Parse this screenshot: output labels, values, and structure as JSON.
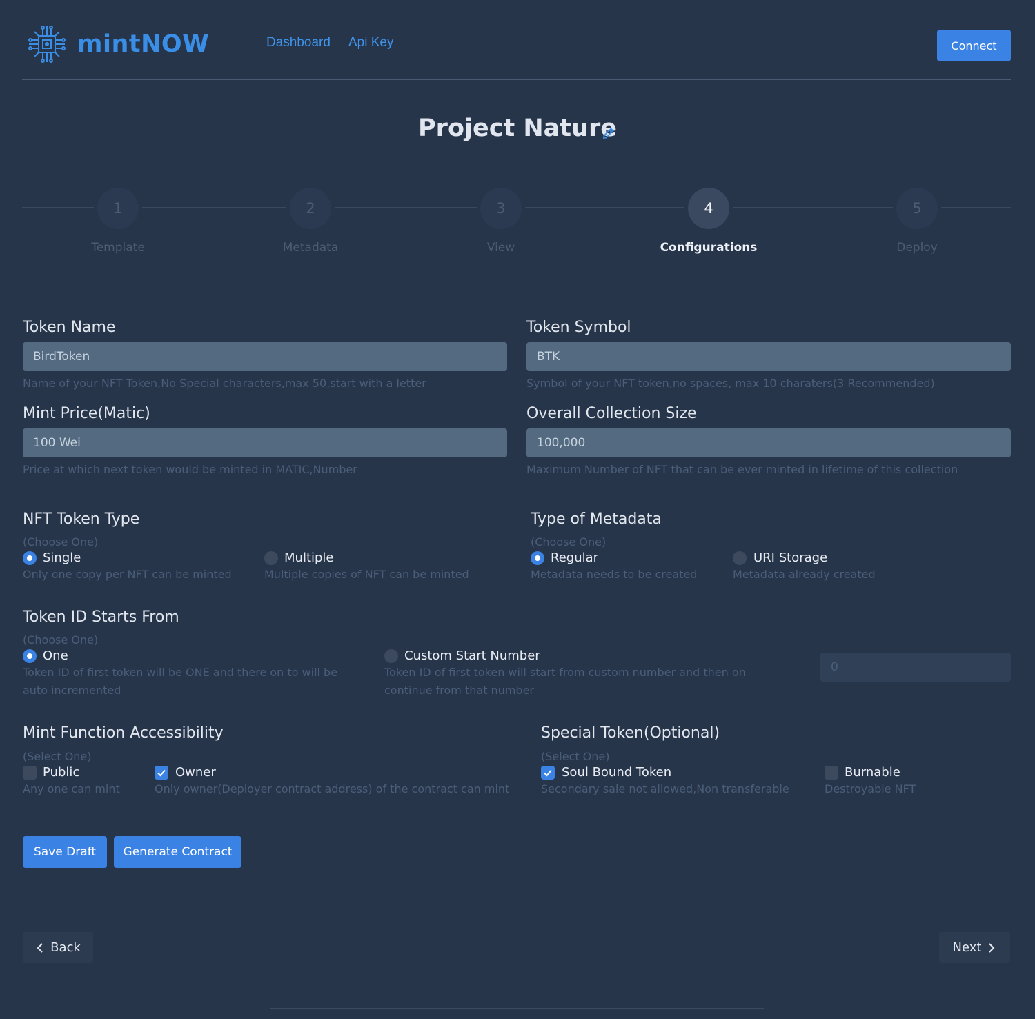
{
  "header": {
    "brand": "mintNOW",
    "nav": [
      "Dashboard",
      "Api Key"
    ],
    "connect_label": "Connect",
    "logo_icon": "chip-circuit-icon"
  },
  "project": {
    "title": "Project Nature",
    "edit_icon": "pencil-icon"
  },
  "stepper": {
    "current_step": 4,
    "steps": [
      {
        "number": "1",
        "label": "Template"
      },
      {
        "number": "2",
        "label": "Metadata"
      },
      {
        "number": "3",
        "label": "View"
      },
      {
        "number": "4",
        "label": "Configurations"
      },
      {
        "number": "5",
        "label": "Deploy"
      }
    ]
  },
  "fields": {
    "token_name": {
      "label": "Token Name",
      "value": "BirdToken",
      "hint": "Name of your NFT Token,No Special characters,max 50,start with a letter"
    },
    "token_symbol": {
      "label": "Token Symbol",
      "value": "BTK",
      "hint": "Symbol of your NFT token,no spaces, max 10 charaters(3 Recommended)"
    },
    "mint_price": {
      "label": "Mint Price(Matic)",
      "value": "100 Wei",
      "hint": "Price at which next token would be minted in MATIC,Number"
    },
    "collection_size": {
      "label": "Overall Collection Size",
      "value": "100,000",
      "hint": "Maximum Number of NFT that can be ever minted in lifetime of this collection"
    }
  },
  "nft_token_type": {
    "title": "NFT Token Type",
    "choose": "(Choose One)",
    "options": [
      {
        "label": "Single",
        "desc": "Only one copy per NFT can be minted",
        "selected": true
      },
      {
        "label": "Multiple",
        "desc": "Multiple copies of NFT can be minted",
        "selected": false
      }
    ]
  },
  "metadata_type": {
    "title": "Type of Metadata",
    "choose": "(Choose One)",
    "options": [
      {
        "label": "Regular",
        "desc": "Metadata needs to be created",
        "selected": true
      },
      {
        "label": "URI Storage",
        "desc": "Metadata already created",
        "selected": false
      }
    ]
  },
  "token_id_start": {
    "title": "Token ID Starts From",
    "choose": "(Choose One)",
    "options": [
      {
        "label": "One",
        "desc_line1": "Token ID of first token will be ONE and there on to will be",
        "desc_line2": "auto incremented",
        "selected": true
      },
      {
        "label": "Custom Start Number",
        "desc_line1": "Token ID of first token will start from custom number and then on",
        "desc_line2": "continue from that number",
        "selected": false
      }
    ],
    "custom_value": "0"
  },
  "mint_access": {
    "title": "Mint Function Accessibility",
    "choose": "(Select One)",
    "options": [
      {
        "label": "Public",
        "desc": "Any one can mint",
        "checked": false
      },
      {
        "label": "Owner",
        "desc": "Only owner(Deployer contract address) of the contract can mint",
        "checked": true
      }
    ]
  },
  "special_token": {
    "title": "Special Token(Optional)",
    "choose": "(Select One)",
    "options": [
      {
        "label": "Soul Bound Token",
        "desc": "Secondary sale not allowed,Non transferable",
        "checked": true
      },
      {
        "label": "Burnable",
        "desc": "Destroyable NFT",
        "checked": false
      }
    ]
  },
  "actions": {
    "save_draft": "Save Draft",
    "generate_contract": "Generate Contract"
  },
  "footer_nav": {
    "back": "Back",
    "next": "Next"
  },
  "colors": {
    "background": "#27354b",
    "accent": "#3a82e4",
    "input": "#536a80",
    "hint": "#4b5e78"
  }
}
